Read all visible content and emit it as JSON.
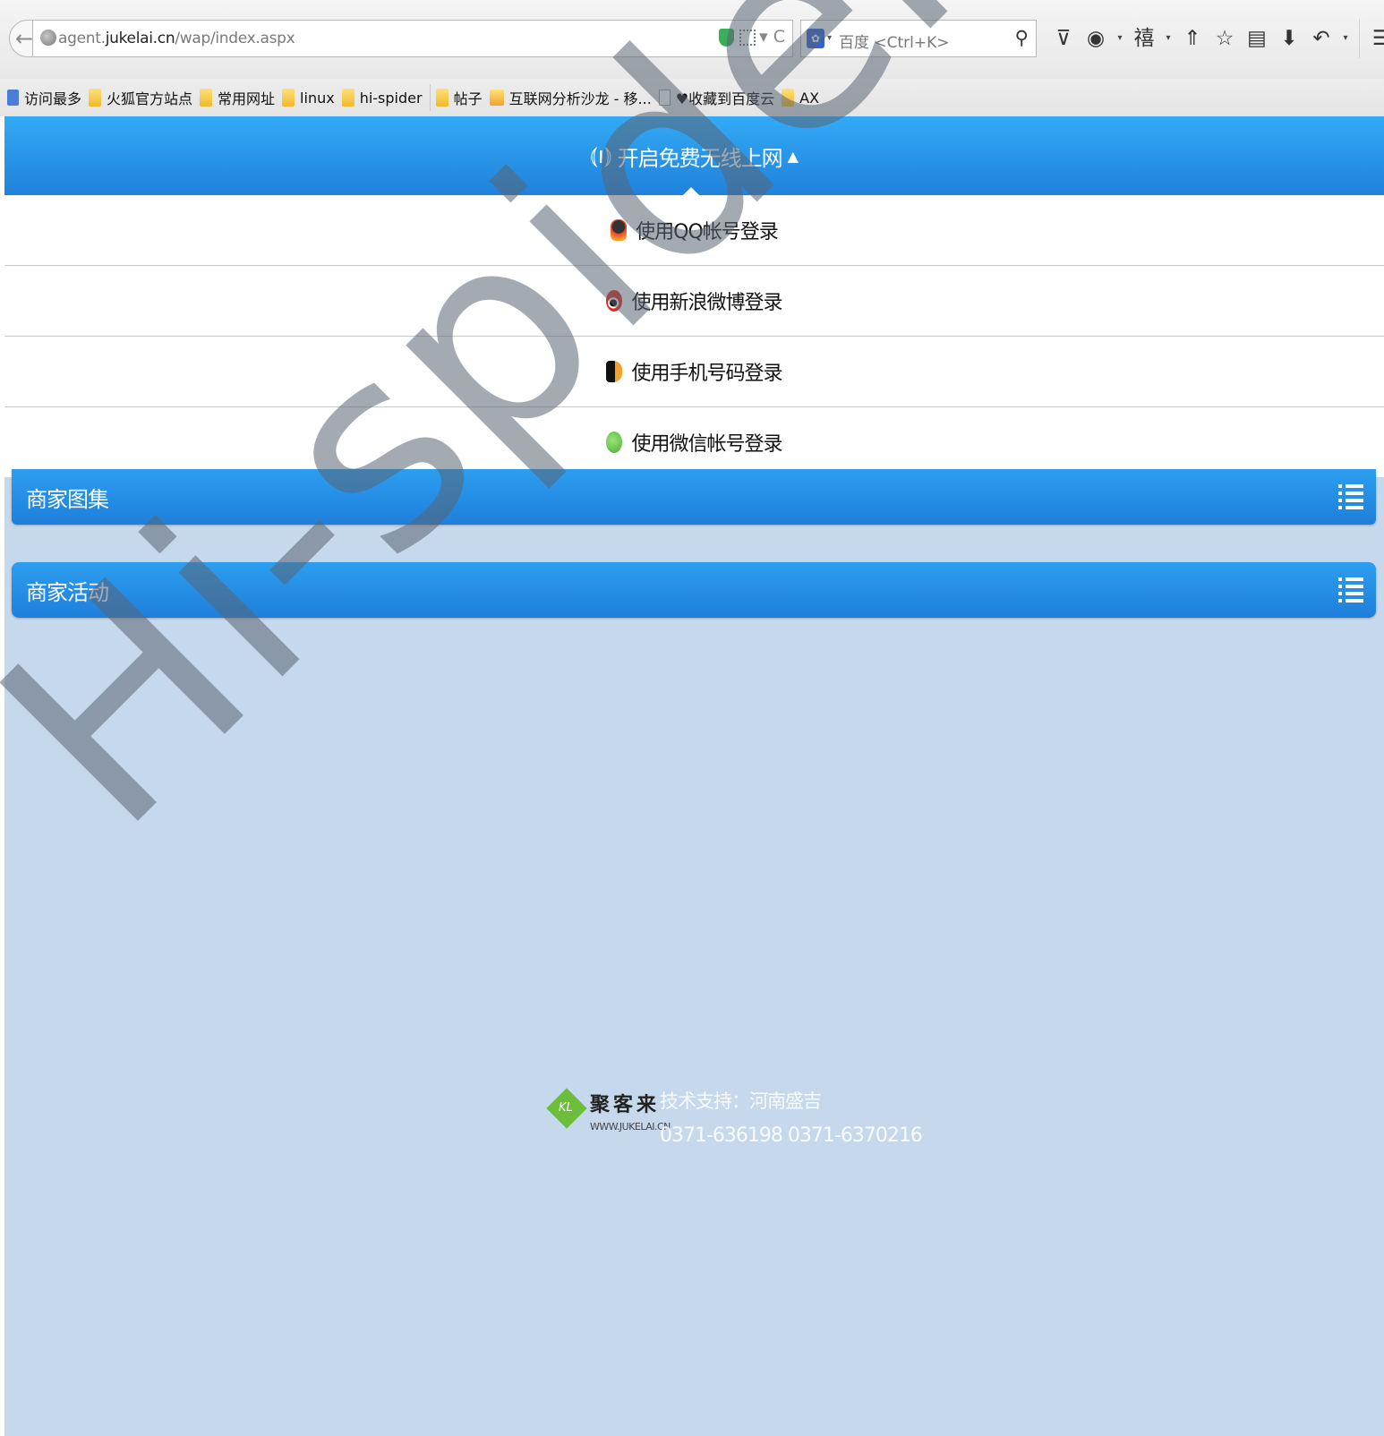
{
  "browser": {
    "url_prefix": "agent.",
    "url_domain": "jukelai.cn",
    "url_path": "/wap/index.aspx",
    "reload_glyph": "▾ C",
    "search_placeholder": "百度 <Ctrl+K>",
    "bookmarks": [
      {
        "label": "访问最多",
        "icon": "image-icon"
      },
      {
        "label": "火狐官方站点",
        "icon": "folder-icon"
      },
      {
        "label": "常用网址",
        "icon": "folder-icon"
      },
      {
        "label": "linux",
        "icon": "folder-icon"
      },
      {
        "label": "hi-spider",
        "icon": "folder-icon"
      },
      {
        "label": "帖子",
        "icon": "folder-icon"
      },
      {
        "label": "互联网分析沙龙 - 移...",
        "icon": "rss-icon"
      },
      {
        "label": "♥收藏到百度云",
        "icon": "page-icon"
      },
      {
        "label": "AX",
        "icon": "folder-icon"
      }
    ]
  },
  "header": {
    "title": "开启免费无线上网",
    "caret": "▲"
  },
  "login_options": [
    {
      "label": "使用QQ帐号登录",
      "icon": "qq-icon"
    },
    {
      "label": "使用新浪微博登录",
      "icon": "weibo-icon"
    },
    {
      "label": "使用手机号码登录",
      "icon": "phone-icon"
    },
    {
      "label": "使用微信帐号登录",
      "icon": "wechat-icon"
    }
  ],
  "sections": [
    {
      "label": "商家图集",
      "icon": "list-icon"
    },
    {
      "label": "商家活动",
      "icon": "list-icon"
    }
  ],
  "footer": {
    "logo_mark": "KL",
    "brand_name": "聚客来",
    "brand_domain": "WWW.JUKELAI.CN",
    "support": "技术支持：河南盛吉",
    "phones": "0371-636198 0371-6370216"
  },
  "watermark": "Hi-spider.com",
  "colors": {
    "header_blue": "#2a96ea",
    "page_background": "#c5d8ec",
    "logo_green": "#6bbd3a"
  }
}
